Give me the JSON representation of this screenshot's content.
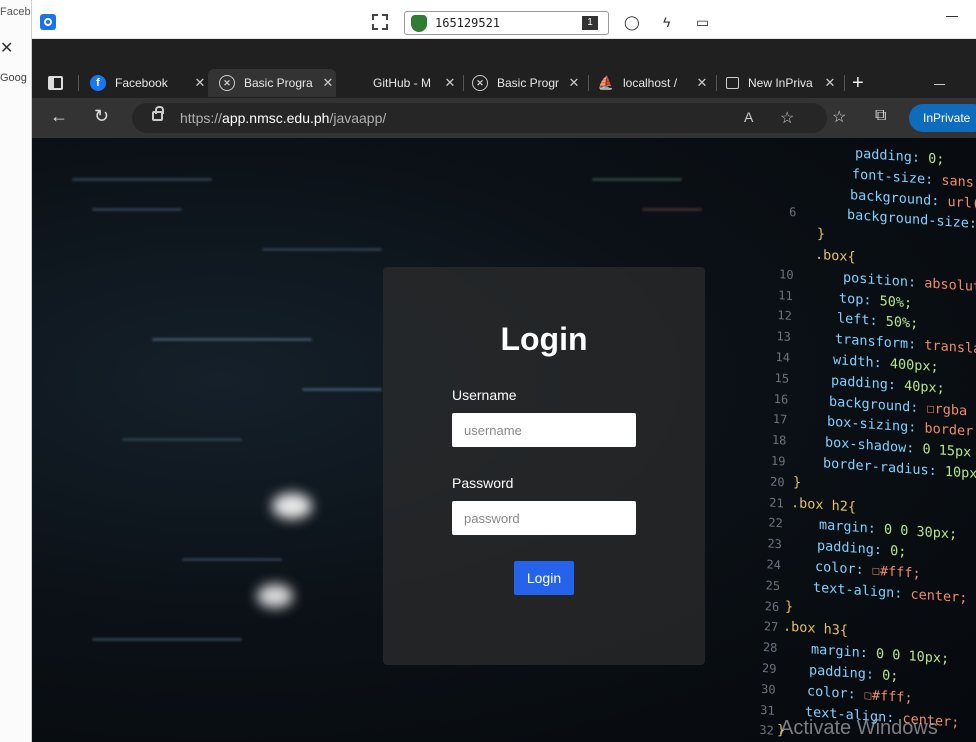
{
  "background_window": {
    "title_fragment": "Faceb",
    "close_glyph": "✕",
    "search_fragment": "Goog"
  },
  "remote_toolbar": {
    "session_id": "165129521",
    "monitor_number": "1",
    "icons": [
      "fullscreen-icon",
      "shield-icon",
      "chat-icon",
      "lightning-icon",
      "display-icon",
      "minimize-icon"
    ]
  },
  "tabs": [
    {
      "label": "Facebook",
      "icon": "facebook-icon",
      "active": false
    },
    {
      "label": "Basic Progra",
      "icon": "basic-prog-icon",
      "active": true
    },
    {
      "label": "GitHub - M",
      "icon": "github-icon",
      "active": false
    },
    {
      "label": "Basic Progr",
      "icon": "basic-prog-icon",
      "active": false
    },
    {
      "label": "localhost /",
      "icon": "phpmyadmin-icon",
      "active": false
    },
    {
      "label": "New InPriva",
      "icon": "inprivate-tab-icon",
      "active": false
    }
  ],
  "address_bar": {
    "url_prefix": "https://",
    "url_host": "app.nmsc.edu.ph",
    "url_path": "/javaapp/",
    "read_aloud": "A",
    "inprivate_label": "InPrivate"
  },
  "login": {
    "title": "Login",
    "username_label": "Username",
    "username_placeholder": "username",
    "password_label": "Password",
    "password_placeholder": "password",
    "button_label": "Login"
  },
  "code_lines": [
    {
      "n": "",
      "t": "padding: 0;"
    },
    {
      "n": "",
      "t": "font-size: sans"
    },
    {
      "n": "",
      "t": "background: url("
    },
    {
      "n": "6",
      "t": "background-size:"
    },
    {
      "n": "",
      "t": "}"
    },
    {
      "n": "",
      "t": ".box{"
    },
    {
      "n": "10",
      "t": "position: absolut"
    },
    {
      "n": "11",
      "t": "top: 50%;"
    },
    {
      "n": "12",
      "t": "left: 50%;"
    },
    {
      "n": "13",
      "t": "transform: transla"
    },
    {
      "n": "14",
      "t": "width: 400px;"
    },
    {
      "n": "15",
      "t": "padding: 40px;"
    },
    {
      "n": "16",
      "t": "background: ☐rgba"
    },
    {
      "n": "17",
      "t": "box-sizing: border"
    },
    {
      "n": "18",
      "t": "box-shadow: 0 15px"
    },
    {
      "n": "19",
      "t": "border-radius: 10px"
    },
    {
      "n": "20",
      "t": "}"
    },
    {
      "n": "21",
      "t": ".box h2{"
    },
    {
      "n": "22",
      "t": "margin: 0 0 30px;"
    },
    {
      "n": "23",
      "t": "padding: 0;"
    },
    {
      "n": "24",
      "t": "color: ☐#fff;"
    },
    {
      "n": "25",
      "t": "text-align: center;"
    },
    {
      "n": "26",
      "t": "}"
    },
    {
      "n": "27",
      "t": ".box h3{"
    },
    {
      "n": "28",
      "t": "margin: 0 0 10px;"
    },
    {
      "n": "29",
      "t": "padding: 0;"
    },
    {
      "n": "30",
      "t": "color: ☐#fff;"
    },
    {
      "n": "31",
      "t": "text-align: center;"
    },
    {
      "n": "32",
      "t": "}"
    }
  ],
  "watermark": "Activate Windows",
  "colors": {
    "accent": "#2563eb",
    "inprivate": "#0f6cbd",
    "tabbar": "#202020",
    "toolbar": "#333333"
  }
}
